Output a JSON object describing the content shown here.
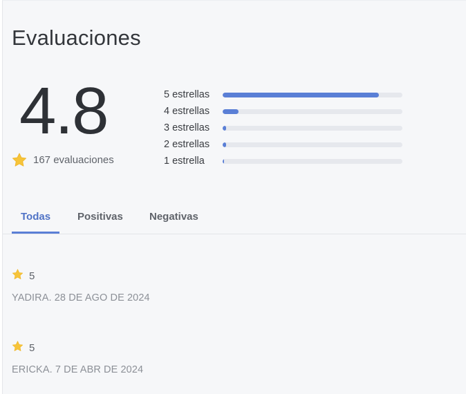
{
  "header": {
    "title": "Evaluaciones"
  },
  "summary": {
    "average": "4.8",
    "count_label": "167 evaluaciones",
    "star_color": "#f6c43a"
  },
  "distribution": [
    {
      "label": "5 estrellas",
      "fraction": 0.87
    },
    {
      "label": "4 estrellas",
      "fraction": 0.09
    },
    {
      "label": "3 estrellas",
      "fraction": 0.02
    },
    {
      "label": "2 estrellas",
      "fraction": 0.02
    },
    {
      "label": "1 estrella",
      "fraction": 0.005
    }
  ],
  "tabs": [
    {
      "label": "Todas",
      "active": true
    },
    {
      "label": "Positivas",
      "active": false
    },
    {
      "label": "Negativas",
      "active": false
    }
  ],
  "reviews": [
    {
      "rating": "5",
      "meta": "YADIRA. 28 DE AGO DE 2024"
    },
    {
      "rating": "5",
      "meta": "ERICKA. 7 DE ABR DE 2024"
    }
  ],
  "colors": {
    "accent": "#5a7fd6",
    "track": "#e6e8ed"
  }
}
